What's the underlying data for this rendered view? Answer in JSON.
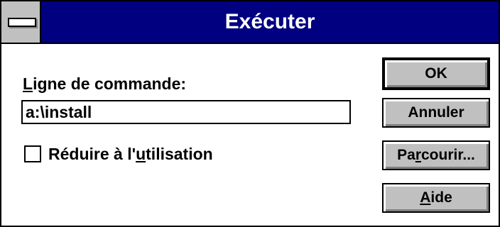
{
  "dialog": {
    "title": "Exécuter",
    "command_label": "Ligne de commande:",
    "command_value": "a:\\install",
    "minimize_option": {
      "label_before": "Réduire à l'",
      "label_accel": "u",
      "label_after": "tilisation",
      "checked": false
    }
  },
  "buttons": {
    "ok": "OK",
    "cancel": "Annuler",
    "browse_before": "Pa",
    "browse_accel": "r",
    "browse_after": "courir...",
    "help_accel": "A",
    "help_after": "ide"
  },
  "colors": {
    "titlebar": "#000080",
    "button_face": "#c0c0c0"
  },
  "icons": {
    "system_menu": "system-menu-icon"
  }
}
